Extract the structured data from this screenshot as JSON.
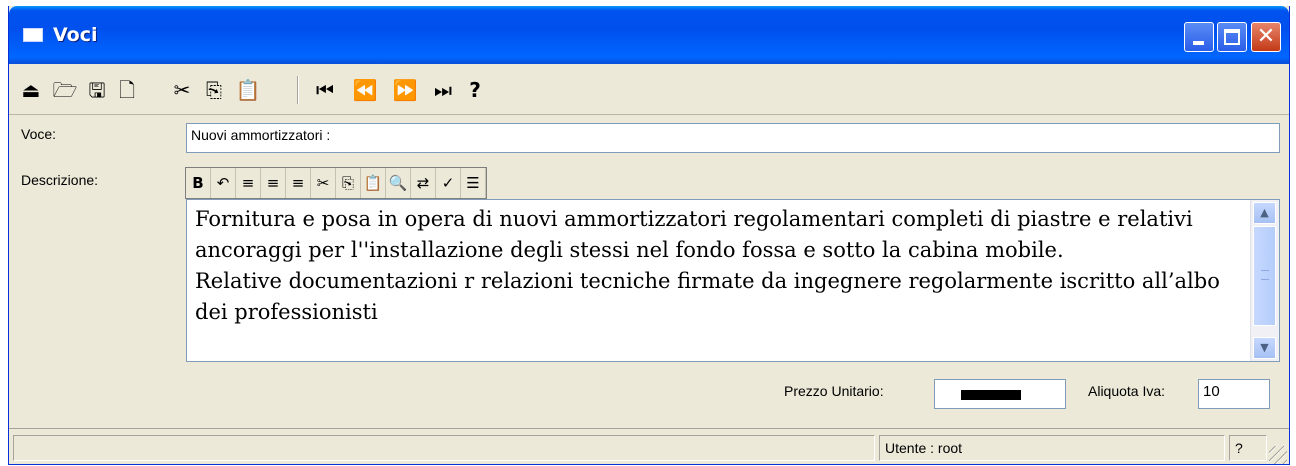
{
  "window": {
    "title": "Voci"
  },
  "toolbar": {
    "tools": [
      {
        "name": "export-icon",
        "glyph": "⏏"
      },
      {
        "name": "open-folder-icon",
        "glyph": "🗁"
      },
      {
        "name": "save-icon",
        "glyph": "🖫"
      },
      {
        "name": "new-document-icon",
        "glyph": "🗋"
      },
      {
        "name": "cut-icon",
        "glyph": "✂"
      },
      {
        "name": "copy-icon",
        "glyph": "⎘"
      },
      {
        "name": "paste-icon",
        "glyph": "📋"
      }
    ],
    "nav": [
      {
        "name": "first-record-icon",
        "glyph": "⏮"
      },
      {
        "name": "previous-record-icon",
        "glyph": "⏪"
      },
      {
        "name": "next-record-icon",
        "glyph": "⏩"
      },
      {
        "name": "last-record-icon",
        "glyph": "⏭"
      }
    ],
    "help_label": "?"
  },
  "form": {
    "voce_label": "Voce:",
    "voce_value": "Nuovi ammortizzatori :",
    "descrizione_label": "Descrizione:",
    "descrizione_text": "Fornitura e posa in opera di nuovi ammortizzatori regolamentari completi di piastre e relativi ancoraggi per l''installazione degli stessi nel fondo fossa e sotto la cabina mobile.\nRelative documentazioni r relazioni tecniche firmate da ingegnere regolarmente iscritto all’albo dei professionisti",
    "prezzo_label": "Prezzo Unitario:",
    "aliquota_label": "Aliquota Iva:",
    "aliquota_value": "10"
  },
  "editor_toolbar": [
    {
      "name": "bold-icon",
      "glyph": "B"
    },
    {
      "name": "undo-icon",
      "glyph": "↶"
    },
    {
      "name": "align-left-icon",
      "glyph": "≡"
    },
    {
      "name": "align-center-icon",
      "glyph": "≡"
    },
    {
      "name": "align-right-icon",
      "glyph": "≡"
    },
    {
      "name": "cut-icon",
      "glyph": "✂"
    },
    {
      "name": "copy-icon",
      "glyph": "⎘"
    },
    {
      "name": "paste-icon",
      "glyph": "📋"
    },
    {
      "name": "find-icon",
      "glyph": "🔍"
    },
    {
      "name": "replace-icon",
      "glyph": "⇄"
    },
    {
      "name": "spellcheck-icon",
      "glyph": "✓"
    },
    {
      "name": "bullet-list-icon",
      "glyph": "☰"
    }
  ],
  "status": {
    "user_text": "Utente : root",
    "help_text": "?"
  }
}
